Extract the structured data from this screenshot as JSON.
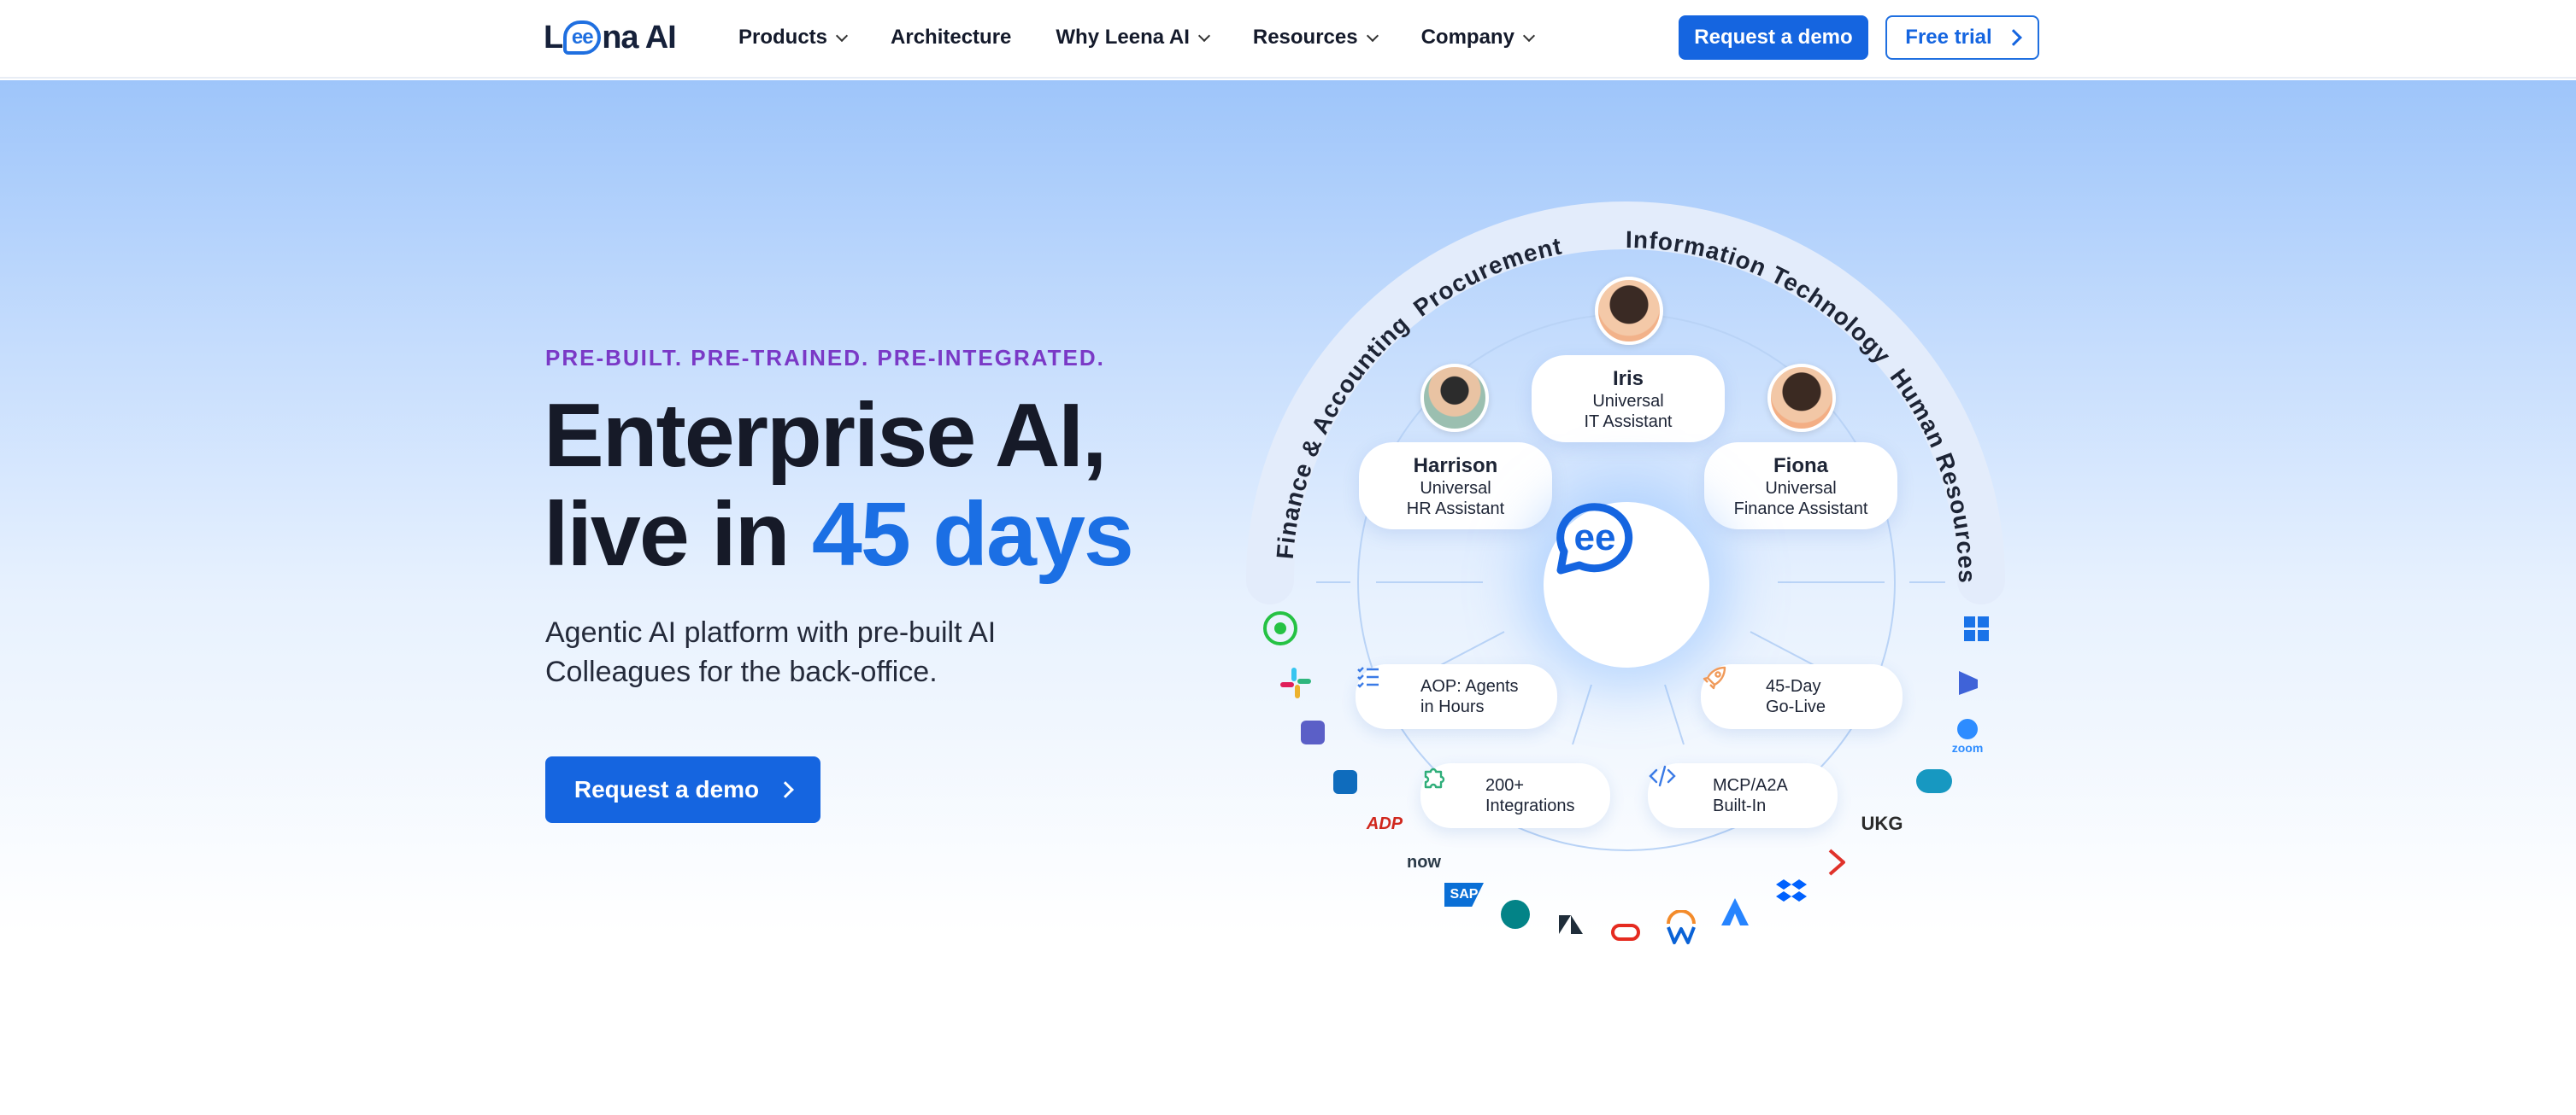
{
  "nav": {
    "logo_pre": "L",
    "logo_mid": "ee",
    "logo_post": "na AI",
    "items": [
      {
        "label": "Products",
        "dropdown": true
      },
      {
        "label": "Architecture",
        "dropdown": false
      },
      {
        "label": "Why Leena AI",
        "dropdown": true
      },
      {
        "label": "Resources",
        "dropdown": true
      },
      {
        "label": "Company",
        "dropdown": true
      }
    ],
    "cta_primary": "Request a demo",
    "cta_secondary": "Free trial"
  },
  "hero": {
    "eyebrow": "PRE-BUILT. PRE-TRAINED. PRE-INTEGRATED.",
    "headline_line1": "Enterprise AI,",
    "headline_line2_pre": "live in ",
    "headline_line2_highlight": "45 days",
    "subtitle": "Agentic AI platform with pre-built AI Colleagues for the back-office.",
    "cta": "Request a demo"
  },
  "diagram": {
    "arc_labels": [
      "Finance & Accounting",
      "Procurement",
      "Information Technology",
      "Human Resources"
    ],
    "assistants": [
      {
        "name": "Iris",
        "role_line1": "Universal",
        "role_line2": "IT Assistant"
      },
      {
        "name": "Harrison",
        "role_line1": "Universal",
        "role_line2": "HR Assistant"
      },
      {
        "name": "Fiona",
        "role_line1": "Universal",
        "role_line2": "Finance Assistant"
      }
    ],
    "features": [
      {
        "line1": "AOP: Agents",
        "line2": "in Hours",
        "icon": "checklist-icon"
      },
      {
        "line1": "45-Day",
        "line2": "Go-Live",
        "icon": "rocket-icon"
      },
      {
        "line1": "200+",
        "line2": "Integrations",
        "icon": "puzzle-icon"
      },
      {
        "line1": "MCP/A2A",
        "line2": "Built-In",
        "icon": "code-icon"
      }
    ],
    "integrations": {
      "now": "now",
      "sap": "SAP",
      "ukg": "UKG",
      "adp": "ADP",
      "zoom": "zoom"
    }
  },
  "colors": {
    "brand": "#1565e0",
    "accent": "#1b6fe4",
    "eyebrow": "#7a39c6"
  }
}
